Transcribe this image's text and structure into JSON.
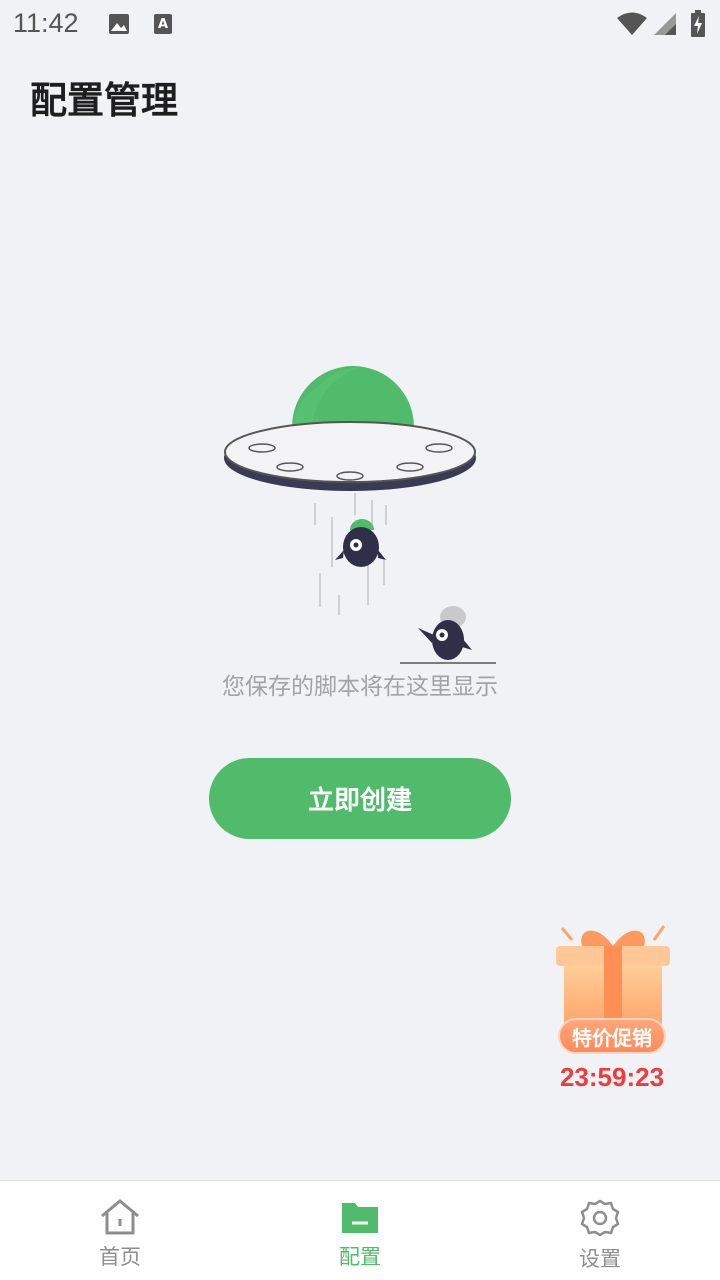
{
  "status_bar": {
    "time": "11:42",
    "icons": [
      "image-icon",
      "text-a-icon",
      "wifi-icon",
      "signal-icon",
      "battery-charging-icon"
    ]
  },
  "page": {
    "title": "配置管理"
  },
  "empty_state": {
    "illustration": "ufo-abduction-illustration",
    "message": "您保存的脚本将在这里显示",
    "create_button_label": "立即创建"
  },
  "promo": {
    "icon": "gift-box-icon",
    "badge_label": "特价促销",
    "countdown": "23:59:23"
  },
  "bottom_nav": {
    "items": [
      {
        "label": "首页",
        "icon": "home-icon",
        "active": false
      },
      {
        "label": "配置",
        "icon": "folder-icon",
        "active": true
      },
      {
        "label": "设置",
        "icon": "gear-icon",
        "active": false
      }
    ]
  },
  "colors": {
    "accent": "#4fbb6b",
    "background": "#f1f2f5",
    "timer": "#ef3b3b",
    "muted_text": "#a0a3a8"
  }
}
